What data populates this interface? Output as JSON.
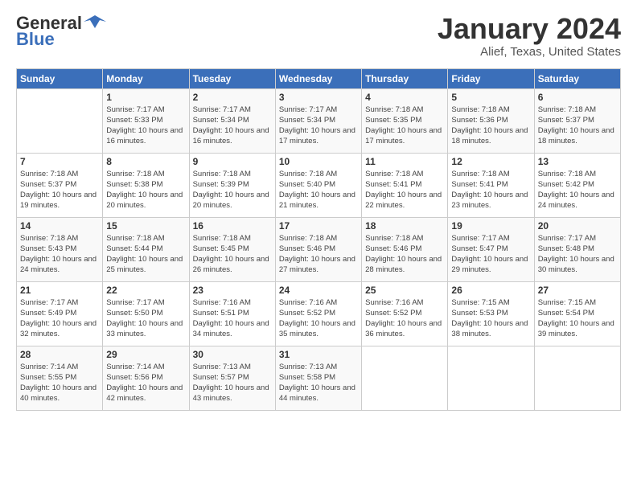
{
  "header": {
    "logo_general": "General",
    "logo_blue": "Blue",
    "month_title": "January 2024",
    "location": "Alief, Texas, United States"
  },
  "weekdays": [
    "Sunday",
    "Monday",
    "Tuesday",
    "Wednesday",
    "Thursday",
    "Friday",
    "Saturday"
  ],
  "weeks": [
    [
      {
        "day": "",
        "sunrise": "",
        "sunset": "",
        "daylight": ""
      },
      {
        "day": "1",
        "sunrise": "Sunrise: 7:17 AM",
        "sunset": "Sunset: 5:33 PM",
        "daylight": "Daylight: 10 hours and 16 minutes."
      },
      {
        "day": "2",
        "sunrise": "Sunrise: 7:17 AM",
        "sunset": "Sunset: 5:34 PM",
        "daylight": "Daylight: 10 hours and 16 minutes."
      },
      {
        "day": "3",
        "sunrise": "Sunrise: 7:17 AM",
        "sunset": "Sunset: 5:34 PM",
        "daylight": "Daylight: 10 hours and 17 minutes."
      },
      {
        "day": "4",
        "sunrise": "Sunrise: 7:18 AM",
        "sunset": "Sunset: 5:35 PM",
        "daylight": "Daylight: 10 hours and 17 minutes."
      },
      {
        "day": "5",
        "sunrise": "Sunrise: 7:18 AM",
        "sunset": "Sunset: 5:36 PM",
        "daylight": "Daylight: 10 hours and 18 minutes."
      },
      {
        "day": "6",
        "sunrise": "Sunrise: 7:18 AM",
        "sunset": "Sunset: 5:37 PM",
        "daylight": "Daylight: 10 hours and 18 minutes."
      }
    ],
    [
      {
        "day": "7",
        "sunrise": "Sunrise: 7:18 AM",
        "sunset": "Sunset: 5:37 PM",
        "daylight": "Daylight: 10 hours and 19 minutes."
      },
      {
        "day": "8",
        "sunrise": "Sunrise: 7:18 AM",
        "sunset": "Sunset: 5:38 PM",
        "daylight": "Daylight: 10 hours and 20 minutes."
      },
      {
        "day": "9",
        "sunrise": "Sunrise: 7:18 AM",
        "sunset": "Sunset: 5:39 PM",
        "daylight": "Daylight: 10 hours and 20 minutes."
      },
      {
        "day": "10",
        "sunrise": "Sunrise: 7:18 AM",
        "sunset": "Sunset: 5:40 PM",
        "daylight": "Daylight: 10 hours and 21 minutes."
      },
      {
        "day": "11",
        "sunrise": "Sunrise: 7:18 AM",
        "sunset": "Sunset: 5:41 PM",
        "daylight": "Daylight: 10 hours and 22 minutes."
      },
      {
        "day": "12",
        "sunrise": "Sunrise: 7:18 AM",
        "sunset": "Sunset: 5:41 PM",
        "daylight": "Daylight: 10 hours and 23 minutes."
      },
      {
        "day": "13",
        "sunrise": "Sunrise: 7:18 AM",
        "sunset": "Sunset: 5:42 PM",
        "daylight": "Daylight: 10 hours and 24 minutes."
      }
    ],
    [
      {
        "day": "14",
        "sunrise": "Sunrise: 7:18 AM",
        "sunset": "Sunset: 5:43 PM",
        "daylight": "Daylight: 10 hours and 24 minutes."
      },
      {
        "day": "15",
        "sunrise": "Sunrise: 7:18 AM",
        "sunset": "Sunset: 5:44 PM",
        "daylight": "Daylight: 10 hours and 25 minutes."
      },
      {
        "day": "16",
        "sunrise": "Sunrise: 7:18 AM",
        "sunset": "Sunset: 5:45 PM",
        "daylight": "Daylight: 10 hours and 26 minutes."
      },
      {
        "day": "17",
        "sunrise": "Sunrise: 7:18 AM",
        "sunset": "Sunset: 5:46 PM",
        "daylight": "Daylight: 10 hours and 27 minutes."
      },
      {
        "day": "18",
        "sunrise": "Sunrise: 7:18 AM",
        "sunset": "Sunset: 5:46 PM",
        "daylight": "Daylight: 10 hours and 28 minutes."
      },
      {
        "day": "19",
        "sunrise": "Sunrise: 7:17 AM",
        "sunset": "Sunset: 5:47 PM",
        "daylight": "Daylight: 10 hours and 29 minutes."
      },
      {
        "day": "20",
        "sunrise": "Sunrise: 7:17 AM",
        "sunset": "Sunset: 5:48 PM",
        "daylight": "Daylight: 10 hours and 30 minutes."
      }
    ],
    [
      {
        "day": "21",
        "sunrise": "Sunrise: 7:17 AM",
        "sunset": "Sunset: 5:49 PM",
        "daylight": "Daylight: 10 hours and 32 minutes."
      },
      {
        "day": "22",
        "sunrise": "Sunrise: 7:17 AM",
        "sunset": "Sunset: 5:50 PM",
        "daylight": "Daylight: 10 hours and 33 minutes."
      },
      {
        "day": "23",
        "sunrise": "Sunrise: 7:16 AM",
        "sunset": "Sunset: 5:51 PM",
        "daylight": "Daylight: 10 hours and 34 minutes."
      },
      {
        "day": "24",
        "sunrise": "Sunrise: 7:16 AM",
        "sunset": "Sunset: 5:52 PM",
        "daylight": "Daylight: 10 hours and 35 minutes."
      },
      {
        "day": "25",
        "sunrise": "Sunrise: 7:16 AM",
        "sunset": "Sunset: 5:52 PM",
        "daylight": "Daylight: 10 hours and 36 minutes."
      },
      {
        "day": "26",
        "sunrise": "Sunrise: 7:15 AM",
        "sunset": "Sunset: 5:53 PM",
        "daylight": "Daylight: 10 hours and 38 minutes."
      },
      {
        "day": "27",
        "sunrise": "Sunrise: 7:15 AM",
        "sunset": "Sunset: 5:54 PM",
        "daylight": "Daylight: 10 hours and 39 minutes."
      }
    ],
    [
      {
        "day": "28",
        "sunrise": "Sunrise: 7:14 AM",
        "sunset": "Sunset: 5:55 PM",
        "daylight": "Daylight: 10 hours and 40 minutes."
      },
      {
        "day": "29",
        "sunrise": "Sunrise: 7:14 AM",
        "sunset": "Sunset: 5:56 PM",
        "daylight": "Daylight: 10 hours and 42 minutes."
      },
      {
        "day": "30",
        "sunrise": "Sunrise: 7:13 AM",
        "sunset": "Sunset: 5:57 PM",
        "daylight": "Daylight: 10 hours and 43 minutes."
      },
      {
        "day": "31",
        "sunrise": "Sunrise: 7:13 AM",
        "sunset": "Sunset: 5:58 PM",
        "daylight": "Daylight: 10 hours and 44 minutes."
      },
      {
        "day": "",
        "sunrise": "",
        "sunset": "",
        "daylight": ""
      },
      {
        "day": "",
        "sunrise": "",
        "sunset": "",
        "daylight": ""
      },
      {
        "day": "",
        "sunrise": "",
        "sunset": "",
        "daylight": ""
      }
    ]
  ]
}
